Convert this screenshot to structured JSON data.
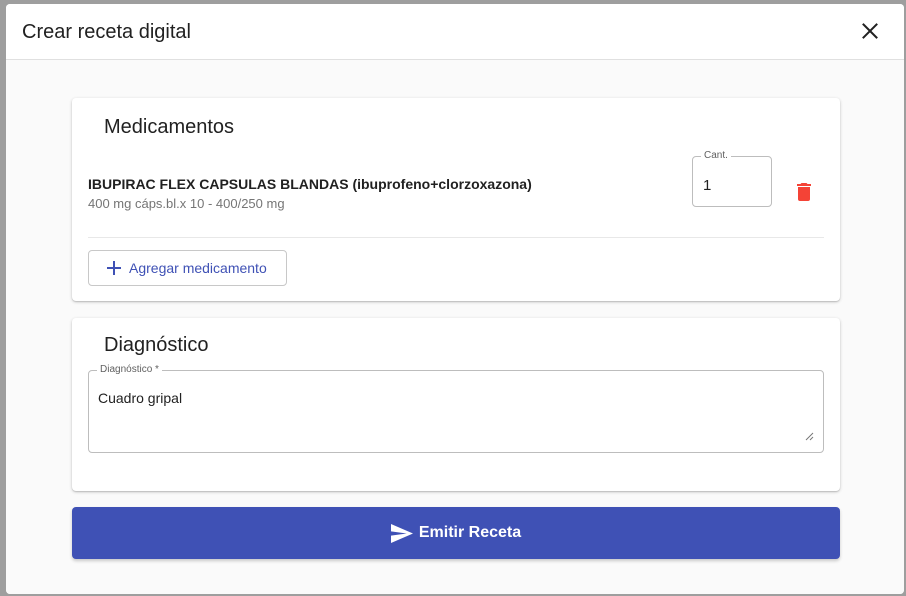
{
  "dialog": {
    "title": "Crear receta digital",
    "close_icon": "close-icon"
  },
  "medications": {
    "title": "Medicamentos",
    "items": [
      {
        "name": "IBUPIRAC FLEX CAPSULAS BLANDAS (ibuprofeno+clorzoxazona)",
        "detail": "400 mg cáps.bl.x 10 - 400/250 mg",
        "quantity_label": "Cant.",
        "quantity": "1",
        "delete_icon": "trash-icon"
      }
    ],
    "add_button_label": "Agregar medicamento",
    "add_icon": "plus-icon"
  },
  "diagnosis": {
    "title": "Diagnóstico",
    "field_label": "Diagnóstico *",
    "value": "Cuadro gripal"
  },
  "submit": {
    "label": "Emitir Receta",
    "icon": "send-icon"
  },
  "colors": {
    "primary": "#3f51b5",
    "danger": "#f44336"
  }
}
